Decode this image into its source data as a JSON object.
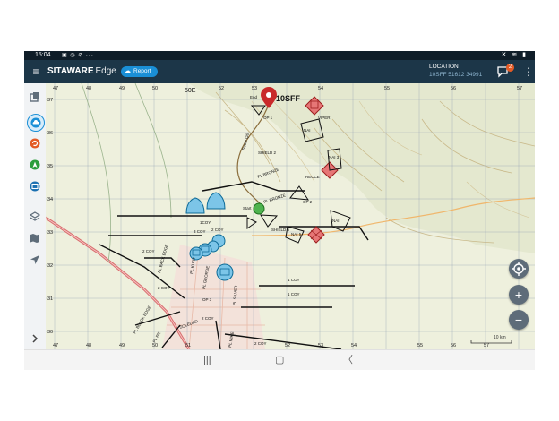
{
  "status_bar": {
    "time": "15:04",
    "left_icons": "▣ ◷ ⊘ ···",
    "right_icons": "✕ ≋ ▮"
  },
  "app_bar": {
    "menu_icon": "hamburger-icon",
    "brand_bold": "SITAWARE",
    "brand_light": "Edge",
    "report_label": "Report",
    "location_label": "LOCATION",
    "location_value": "10SFF 51612 34991",
    "chat_badge": "2"
  },
  "sidebar": {
    "items": [
      {
        "icon": "layers-stack-icon",
        "color": "#5e6c79"
      },
      {
        "icon": "cloud-icon",
        "color": "#1a8fd6"
      },
      {
        "icon": "refresh-icon",
        "color": "#e35b26"
      },
      {
        "icon": "navigation-icon",
        "color": "#2a9d3a"
      },
      {
        "icon": "window-icon",
        "color": "#1a6fb0"
      },
      {
        "icon": "layers-icon",
        "color": "#5e6c79"
      },
      {
        "icon": "map-icon",
        "color": "#5e6c79"
      },
      {
        "icon": "send-icon",
        "color": "#5e6c79"
      }
    ],
    "expand_icon": "chevron-right-icon"
  },
  "map": {
    "grid_top": [
      "47",
      "48",
      "49",
      "50",
      "51",
      "52",
      "53",
      "54",
      "55",
      "56",
      "57"
    ],
    "grid_bottom": [
      "47",
      "48",
      "49",
      "50",
      "51",
      "52",
      "53",
      "54",
      "55",
      "56",
      "57"
    ],
    "grid_left": [
      "37",
      "36",
      "35",
      "34",
      "33",
      "32",
      "31",
      "30"
    ],
    "zone_label": "50E",
    "callsign": "10SFF",
    "labels": {
      "end": "End",
      "op1": "OP 1",
      "op2": "OP 2",
      "op3": "OP 3",
      "shield2": "SHIELD 2",
      "viper": "VIPER",
      "nai1": "NAI",
      "nai2": "NAI 3",
      "nai3": "NAI",
      "recce": "RECCE",
      "bronze1": "PL BRONZE",
      "bronze2": "PL BRONZE",
      "start": "Start",
      "rte": "Route Q6",
      "coy1": "1 COY",
      "coy1b": "1 COY",
      "coy2": "2 COY",
      "coy2b": "2 COY",
      "coy2c": "2 COY",
      "coy2d": "2 COY",
      "coy2e": "2 COY",
      "coy3": "3 COY",
      "coy1c": "1COY",
      "pl_george": "PL GEORGE",
      "pl_kurt": "PL KURT",
      "pl_back": "PL BACK EDGE",
      "pl_black": "PL BLACK EDGE",
      "pl_rr": "PL RR",
      "pl_silver": "PL SILVER",
      "pl_mike": "PL MIKE",
      "soledad": "SOLEDAD",
      "shield5": "SHIELD 5",
      "nai5": "NAI 5",
      "scale": "10 km"
    }
  },
  "nav": {
    "recents": "|||",
    "home": "▢",
    "back": "〈"
  },
  "fab": {
    "locate_icon": "crosshair-icon",
    "zoom_in": "+",
    "zoom_out": "−"
  }
}
